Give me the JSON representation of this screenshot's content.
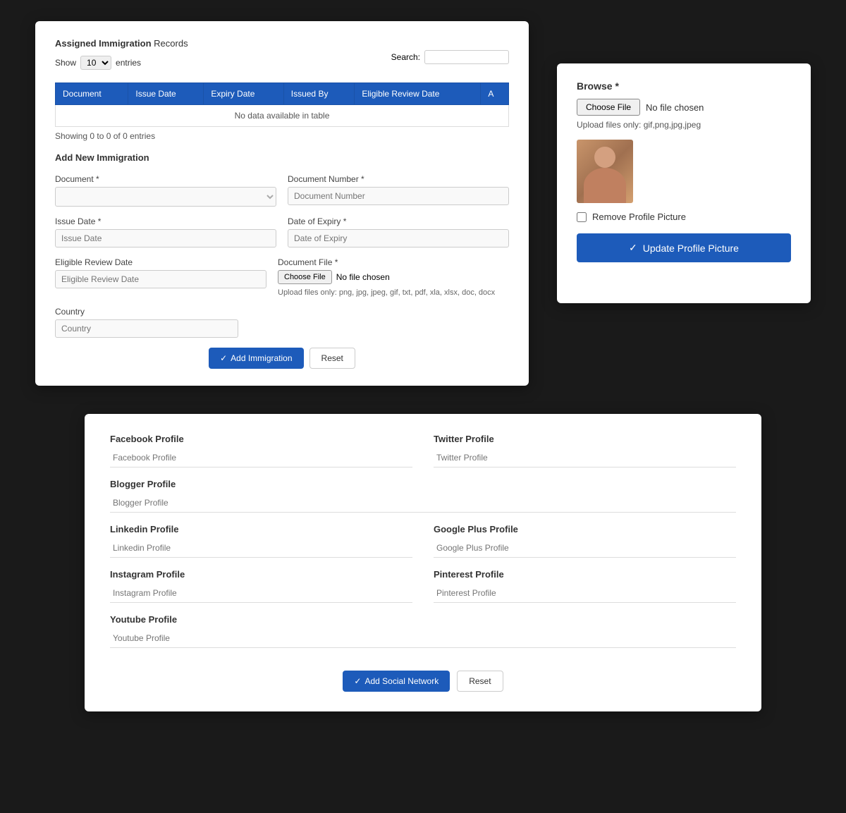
{
  "immigration": {
    "section_title_plain": "Assigned Immigration",
    "section_title_bold": "Records",
    "show_label": "Show",
    "entries_label": "entries",
    "show_value": "10",
    "search_label": "Search:",
    "table": {
      "columns": [
        "Document",
        "Issue Date",
        "Expiry Date",
        "Issued By",
        "Eligible Review Date",
        "A"
      ],
      "no_data_message": "No data available in table",
      "entries_info": "Showing 0 to 0 of 0 entries"
    },
    "add_new_title": "Add New Immigration",
    "form": {
      "document_label": "Document *",
      "document_number_label": "Document Number *",
      "document_number_placeholder": "Document Number",
      "issue_date_label": "Issue Date *",
      "issue_date_placeholder": "Issue Date",
      "date_of_expiry_label": "Date of Expiry *",
      "date_of_expiry_placeholder": "Date of Expiry",
      "document_file_label": "Document File *",
      "choose_file_label": "Choose File",
      "no_file_text": "No file chosen",
      "file_hint": "Upload files only: png, jpg, jpeg, gif, txt, pdf, xla, xlsx, doc, docx",
      "eligible_review_label": "Eligible Review Date",
      "eligible_review_placeholder": "Eligible Review Date",
      "country_label": "Country",
      "country_placeholder": "Country",
      "add_btn": "Add Immigration",
      "reset_btn": "Reset"
    }
  },
  "profile_picture": {
    "browse_label": "Browse *",
    "choose_file_label": "Choose File",
    "no_file_text": "No file chosen",
    "upload_hint": "Upload files only: gif,png,jpg,jpeg",
    "remove_label": "Remove Profile Picture",
    "update_btn": "Update Profile Picture"
  },
  "social_network": {
    "fields": [
      {
        "label": "Facebook Profile",
        "placeholder": "Facebook Profile",
        "id": "facebook",
        "full": false
      },
      {
        "label": "Twitter Profile",
        "placeholder": "Twitter Profile",
        "id": "twitter",
        "full": false
      },
      {
        "label": "Blogger Profile",
        "placeholder": "Blogger Profile",
        "id": "blogger",
        "full": true
      },
      {
        "label": "Linkedin Profile",
        "placeholder": "Linkedin Profile",
        "id": "linkedin",
        "full": false
      },
      {
        "label": "Google Plus Profile",
        "placeholder": "Google Plus Profile",
        "id": "googleplus",
        "full": false
      },
      {
        "label": "Instagram Profile",
        "placeholder": "Instagram Profile",
        "id": "instagram",
        "full": false
      },
      {
        "label": "Pinterest Profile",
        "placeholder": "Pinterest Profile",
        "id": "pinterest",
        "full": false
      },
      {
        "label": "Youtube Profile",
        "placeholder": "Youtube Profile",
        "id": "youtube",
        "full": true
      }
    ],
    "add_btn": "Add Social Network",
    "reset_btn": "Reset"
  }
}
